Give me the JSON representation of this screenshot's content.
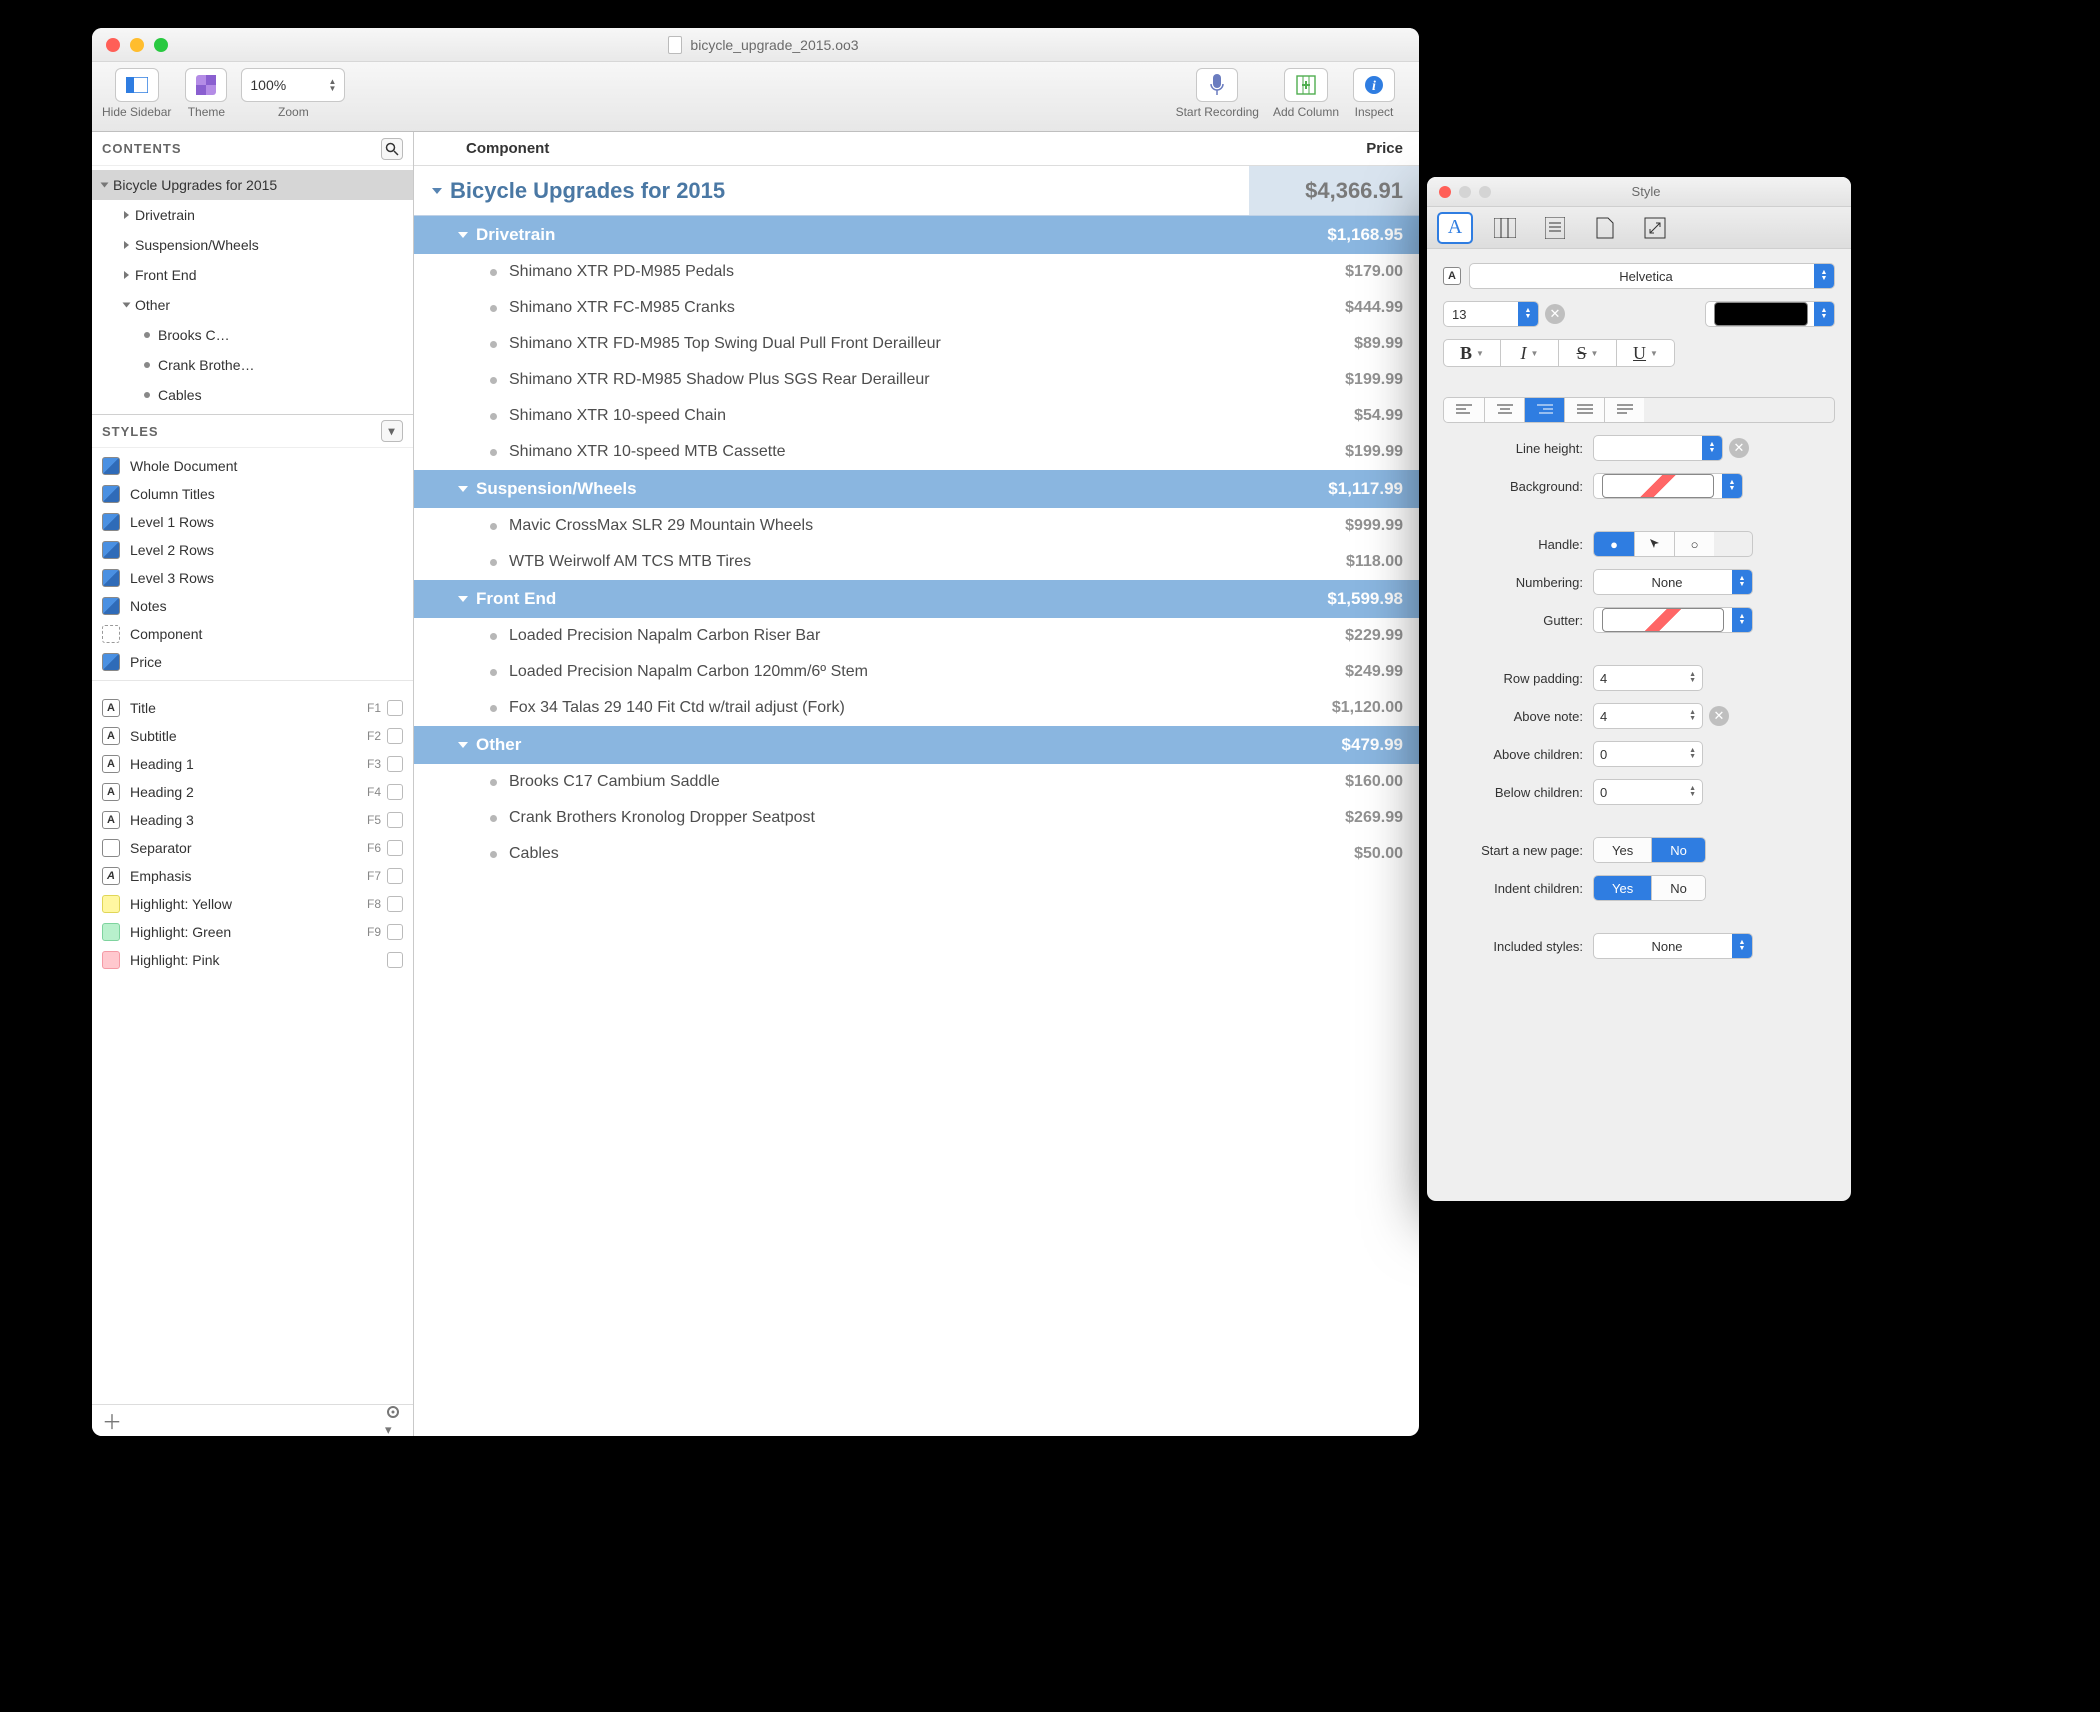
{
  "window": {
    "title": "bicycle_upgrade_2015.oo3"
  },
  "toolbar": {
    "hide_sidebar": "Hide Sidebar",
    "theme": "Theme",
    "zoom_label": "Zoom",
    "zoom_value": "100%",
    "start_recording": "Start Recording",
    "add_column": "Add Column",
    "inspect": "Inspect"
  },
  "sidebar": {
    "contents_label": "CONTENTS",
    "styles_label": "STYLES",
    "tree": {
      "root": "Bicycle Upgrades for 2015",
      "drivetrain": "Drivetrain",
      "suspension": "Suspension/Wheels",
      "frontend": "Front End",
      "other": "Other",
      "other_children": [
        "Brooks C…",
        "Crank Brothe…",
        "Cables"
      ]
    },
    "styles": [
      "Whole Document",
      "Column Titles",
      "Level 1 Rows",
      "Level 2 Rows",
      "Level 3 Rows",
      "Notes",
      "Component",
      "Price"
    ],
    "named_styles": [
      {
        "n": "Title",
        "k": "F1"
      },
      {
        "n": "Subtitle",
        "k": "F2"
      },
      {
        "n": "Heading 1",
        "k": "F3"
      },
      {
        "n": "Heading 2",
        "k": "F4"
      },
      {
        "n": "Heading 3",
        "k": "F5"
      },
      {
        "n": "Separator",
        "k": "F6"
      },
      {
        "n": "Emphasis",
        "k": "F7"
      },
      {
        "n": "Highlight: Yellow",
        "k": "F8"
      },
      {
        "n": "Highlight: Green",
        "k": "F9"
      },
      {
        "n": "Highlight: Pink",
        "k": ""
      }
    ]
  },
  "columns": {
    "component": "Component",
    "price": "Price"
  },
  "outline": {
    "root": {
      "name": "Bicycle Upgrades for 2015",
      "price": "$4,366.91"
    },
    "sections": [
      {
        "name": "Drivetrain",
        "price": "$1,168.95",
        "items": [
          {
            "name": "Shimano XTR PD-M985 Pedals",
            "price": "$179.00"
          },
          {
            "name": "Shimano XTR FC-M985 Cranks",
            "price": "$444.99"
          },
          {
            "name": "Shimano XTR FD-M985 Top Swing Dual Pull Front Derailleur",
            "price": "$89.99"
          },
          {
            "name": "Shimano XTR RD-M985 Shadow Plus SGS Rear Derailleur",
            "price": "$199.99"
          },
          {
            "name": "Shimano XTR 10-speed Chain",
            "price": "$54.99"
          },
          {
            "name": "Shimano XTR 10-speed MTB Cassette",
            "price": "$199.99"
          }
        ]
      },
      {
        "name": "Suspension/Wheels",
        "price": "$1,117.99",
        "items": [
          {
            "name": "Mavic CrossMax SLR 29 Mountain Wheels",
            "price": "$999.99"
          },
          {
            "name": "WTB Weirwolf AM TCS MTB Tires",
            "price": "$118.00"
          }
        ]
      },
      {
        "name": "Front End",
        "price": "$1,599.98",
        "items": [
          {
            "name": "Loaded Precision Napalm Carbon Riser Bar",
            "price": "$229.99"
          },
          {
            "name": "Loaded Precision Napalm Carbon 120mm/6º Stem",
            "price": "$249.99"
          },
          {
            "name": "Fox 34 Talas 29 140 Fit Ctd w/trail adjust (Fork)",
            "price": "$1,120.00"
          }
        ]
      },
      {
        "name": "Other",
        "price": "$479.99",
        "items": [
          {
            "name": "Brooks C17 Cambium Saddle",
            "price": "$160.00"
          },
          {
            "name": "Crank Brothers Kronolog Dropper Seatpost",
            "price": "$269.99"
          },
          {
            "name": "Cables",
            "price": "$50.00"
          }
        ]
      }
    ]
  },
  "inspector": {
    "title": "Style",
    "font": "Helvetica",
    "size": "13",
    "line_height_label": "Line height:",
    "line_height": "",
    "background_label": "Background:",
    "handle_label": "Handle:",
    "numbering_label": "Numbering:",
    "numbering": "None",
    "gutter_label": "Gutter:",
    "row_padding_label": "Row padding:",
    "row_padding": "4",
    "above_note_label": "Above note:",
    "above_note": "4",
    "above_children_label": "Above children:",
    "above_children": "0",
    "below_children_label": "Below children:",
    "below_children": "0",
    "new_page_label": "Start a new page:",
    "yes": "Yes",
    "no": "No",
    "indent_children_label": "Indent children:",
    "included_styles_label": "Included styles:",
    "included_styles": "None"
  }
}
